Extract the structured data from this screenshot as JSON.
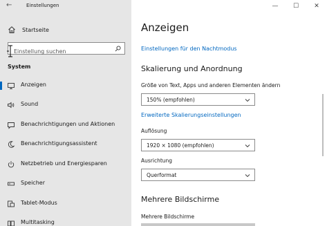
{
  "window": {
    "title": "Einstellungen",
    "controls": {
      "minimize": "—",
      "maximize": "☐",
      "close": "✕"
    }
  },
  "sidebar": {
    "home_label": "Startseite",
    "search_placeholder": "Einstellung suchen",
    "section": "System",
    "items": [
      {
        "label": "Anzeigen",
        "icon": "monitor-icon",
        "selected": true
      },
      {
        "label": "Sound",
        "icon": "speaker-icon",
        "selected": false
      },
      {
        "label": "Benachrichtigungen und Aktionen",
        "icon": "notification-icon",
        "selected": false
      },
      {
        "label": "Benachrichtigungsassistent",
        "icon": "moon-icon",
        "selected": false
      },
      {
        "label": "Netzbetrieb und Energiesparen",
        "icon": "power-icon",
        "selected": false
      },
      {
        "label": "Speicher",
        "icon": "storage-icon",
        "selected": false
      },
      {
        "label": "Tablet-Modus",
        "icon": "tablet-icon",
        "selected": false
      },
      {
        "label": "Multitasking",
        "icon": "multitasking-icon",
        "selected": false
      }
    ]
  },
  "main": {
    "title": "Anzeigen",
    "night_light_link": "Einstellungen für den Nachtmodus",
    "scaling_heading": "Skalierung und Anordnung",
    "scale_label": "Größe von Text, Apps und anderen Elementen ändern",
    "scale_value": "150% (empfohlen)",
    "advanced_scaling_link": "Erweiterte Skalierungseinstellungen",
    "resolution_label": "Auflösung",
    "resolution_value": "1920 × 1080 (empfohlen)",
    "orientation_label": "Ausrichtung",
    "orientation_value": "Querformat",
    "multi_heading": "Mehrere Bildschirme",
    "multi_label": "Mehrere Bildschirme"
  },
  "colors": {
    "accent": "#0067c0",
    "sidebar_bg": "#e6e6e6"
  }
}
